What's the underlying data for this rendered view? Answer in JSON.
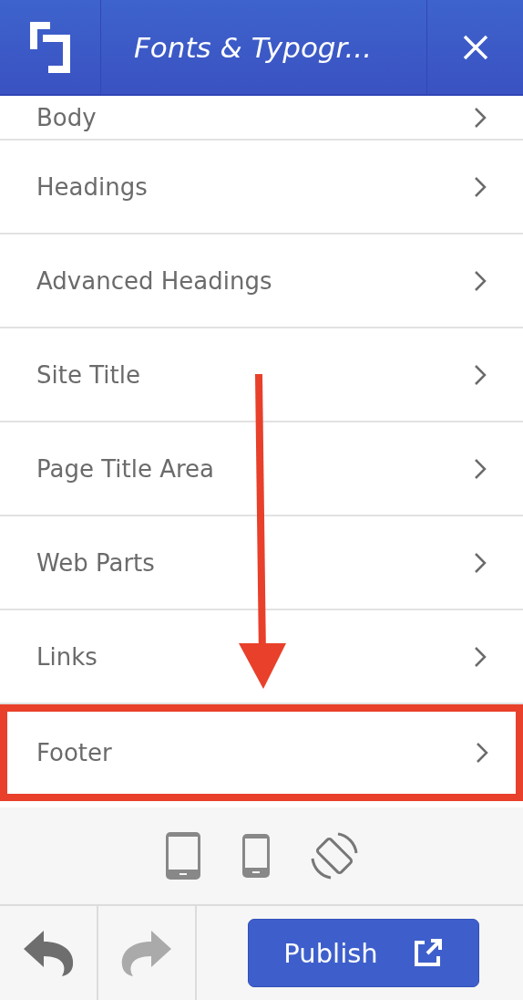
{
  "header": {
    "title": "Fonts & Typogr..."
  },
  "items": [
    {
      "label": "Body",
      "highlighted": false
    },
    {
      "label": "Headings",
      "highlighted": false
    },
    {
      "label": "Advanced Headings",
      "highlighted": false
    },
    {
      "label": "Site Title",
      "highlighted": false
    },
    {
      "label": "Page Title Area",
      "highlighted": false
    },
    {
      "label": "Web Parts",
      "highlighted": false
    },
    {
      "label": "Links",
      "highlighted": false
    },
    {
      "label": "Footer",
      "highlighted": true
    }
  ],
  "devices": [
    {
      "kind": "tablet"
    },
    {
      "kind": "phone"
    },
    {
      "kind": "rotate"
    }
  ],
  "history": [
    {
      "kind": "undo",
      "disabled": false
    },
    {
      "kind": "redo",
      "disabled": true
    }
  ],
  "publish": {
    "label": "Publish"
  }
}
